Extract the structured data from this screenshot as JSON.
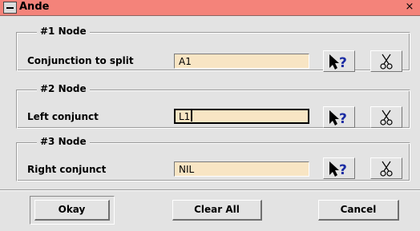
{
  "window": {
    "title": "Ande",
    "close_glyph": "×",
    "menu_icon": "window-menu-icon"
  },
  "groups": [
    {
      "legend": "#1 Node",
      "label": "Conjunction to split",
      "value": "A1",
      "focused": false
    },
    {
      "legend": "#2 Node",
      "label": "Left conjunct",
      "value": "L1",
      "focused": true
    },
    {
      "legend": "#3 Node",
      "label": "Right conjunct",
      "value": "NIL",
      "focused": false
    }
  ],
  "tools": {
    "pick_icon": "pointer-question-icon",
    "cut_icon": "scissors-icon"
  },
  "buttons": {
    "okay": "Okay",
    "clear_all": "Clear All",
    "cancel": "Cancel"
  },
  "colors": {
    "titlebar": "#f4837a",
    "field_bg": "#f8e5c4",
    "window_bg": "#e3e3e3"
  }
}
